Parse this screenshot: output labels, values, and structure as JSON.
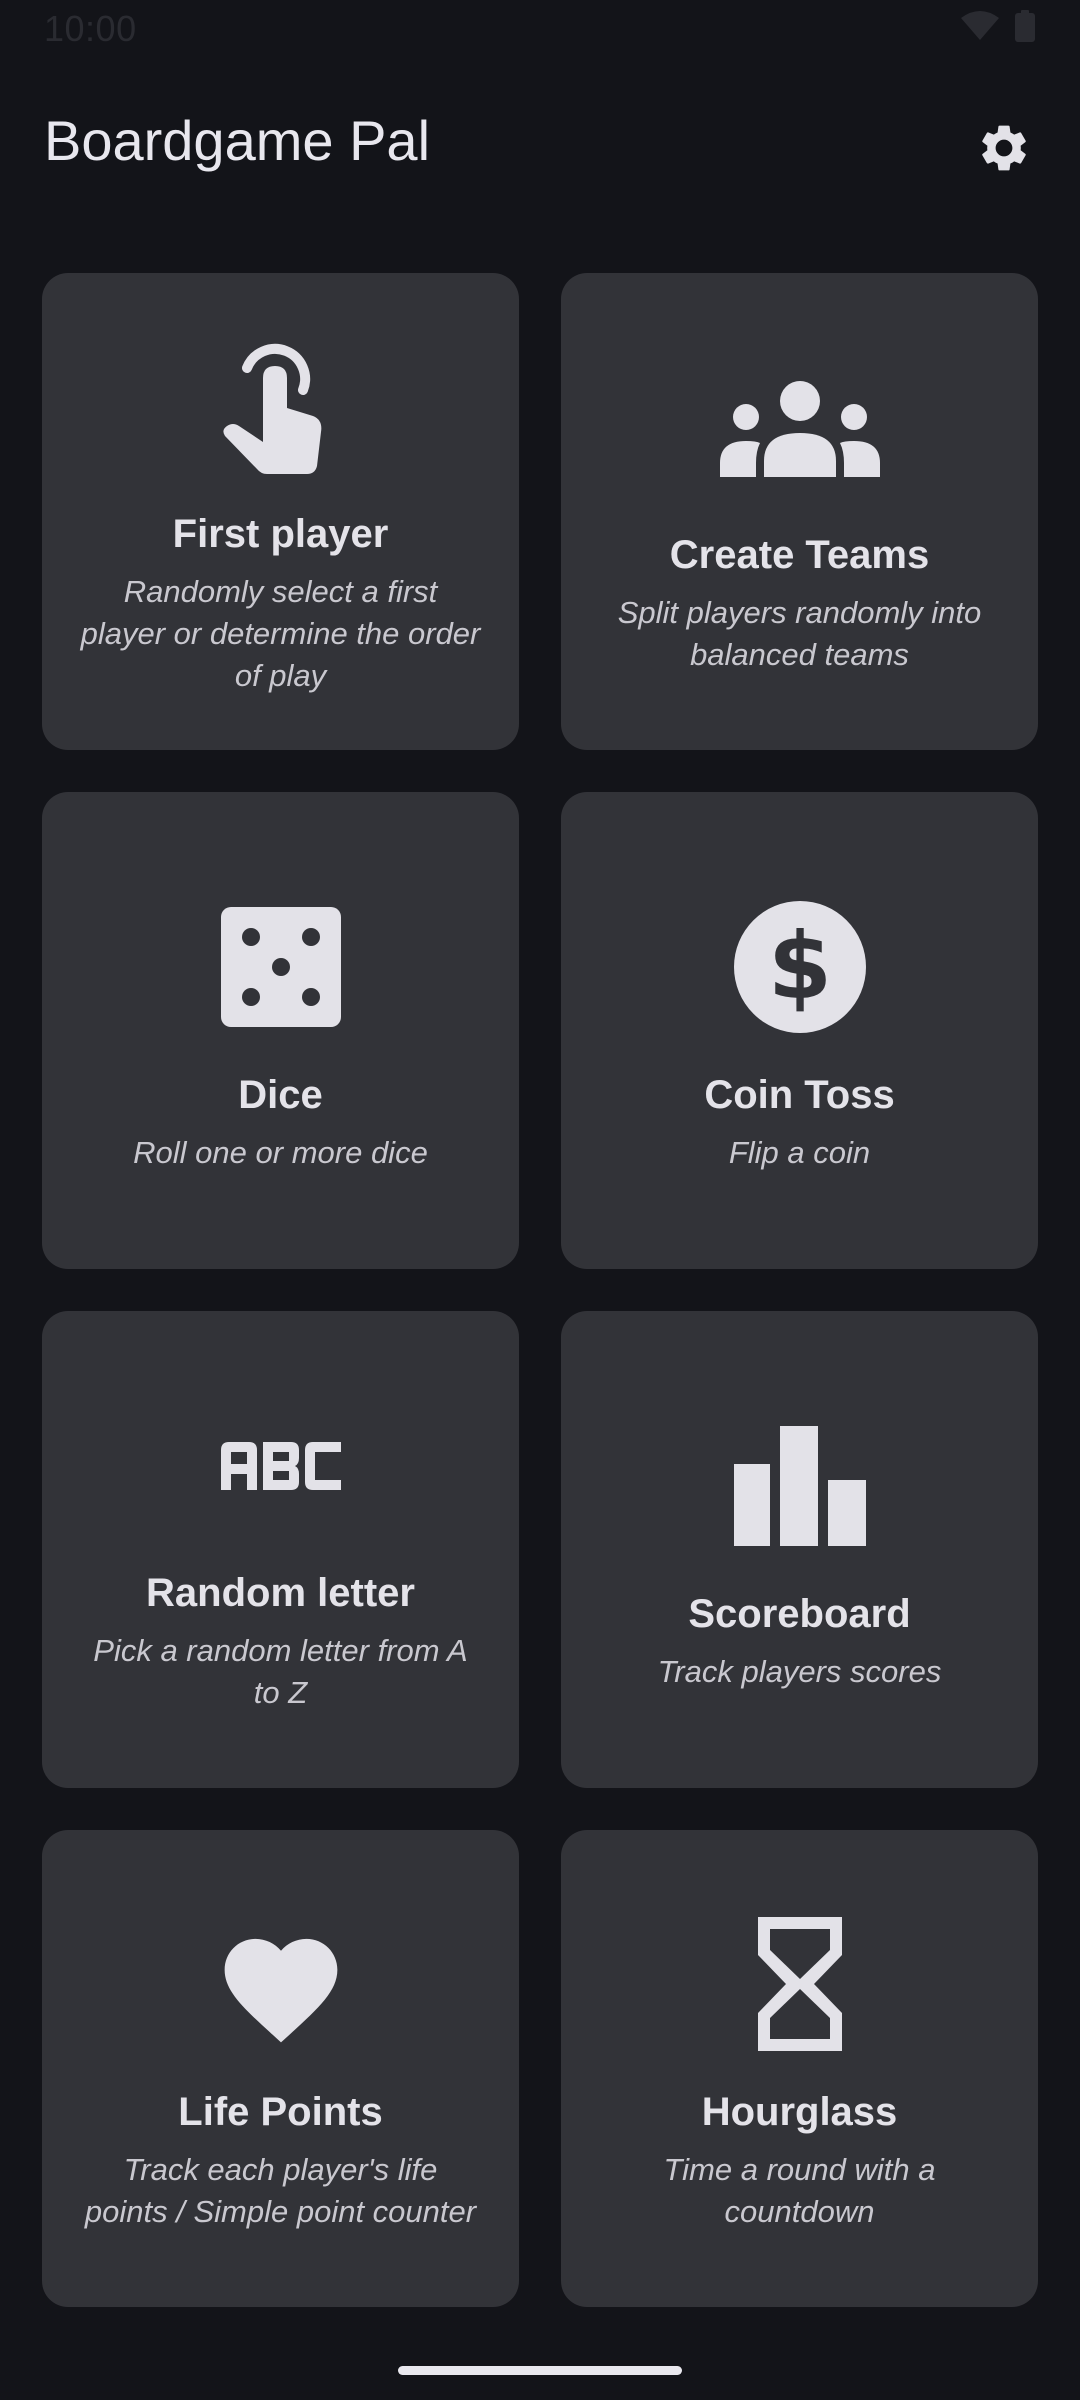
{
  "status_bar": {
    "time": "10:00",
    "icons": [
      "wifi-icon",
      "battery-icon"
    ]
  },
  "app_bar": {
    "title": "Boardgame Pal",
    "settings_icon": "gear-icon"
  },
  "cards": [
    {
      "icon": "tap-finger-icon",
      "title": "First player",
      "description": "Randomly select a first player or determine the order of play"
    },
    {
      "icon": "groups-icon",
      "title": "Create Teams",
      "description": "Split players randomly into balanced teams"
    },
    {
      "icon": "dice-icon",
      "title": "Dice",
      "description": "Roll one or more dice"
    },
    {
      "icon": "dollar-coin-icon",
      "title": "Coin Toss",
      "description": "Flip a coin"
    },
    {
      "icon": "abc-icon",
      "title": "Random letter",
      "description": "Pick a random letter from A to Z"
    },
    {
      "icon": "bar-chart-icon",
      "title": "Scoreboard",
      "description": "Track players scores"
    },
    {
      "icon": "heart-icon",
      "title": "Life Points",
      "description": "Track each player's life points / Simple point counter"
    },
    {
      "icon": "hourglass-icon",
      "title": "Hourglass",
      "description": "Time a round with a countdown"
    }
  ],
  "colors": {
    "background": "#131419",
    "card": "#323338",
    "text": "#e4e3e9",
    "icon": "#e3e2e8"
  }
}
